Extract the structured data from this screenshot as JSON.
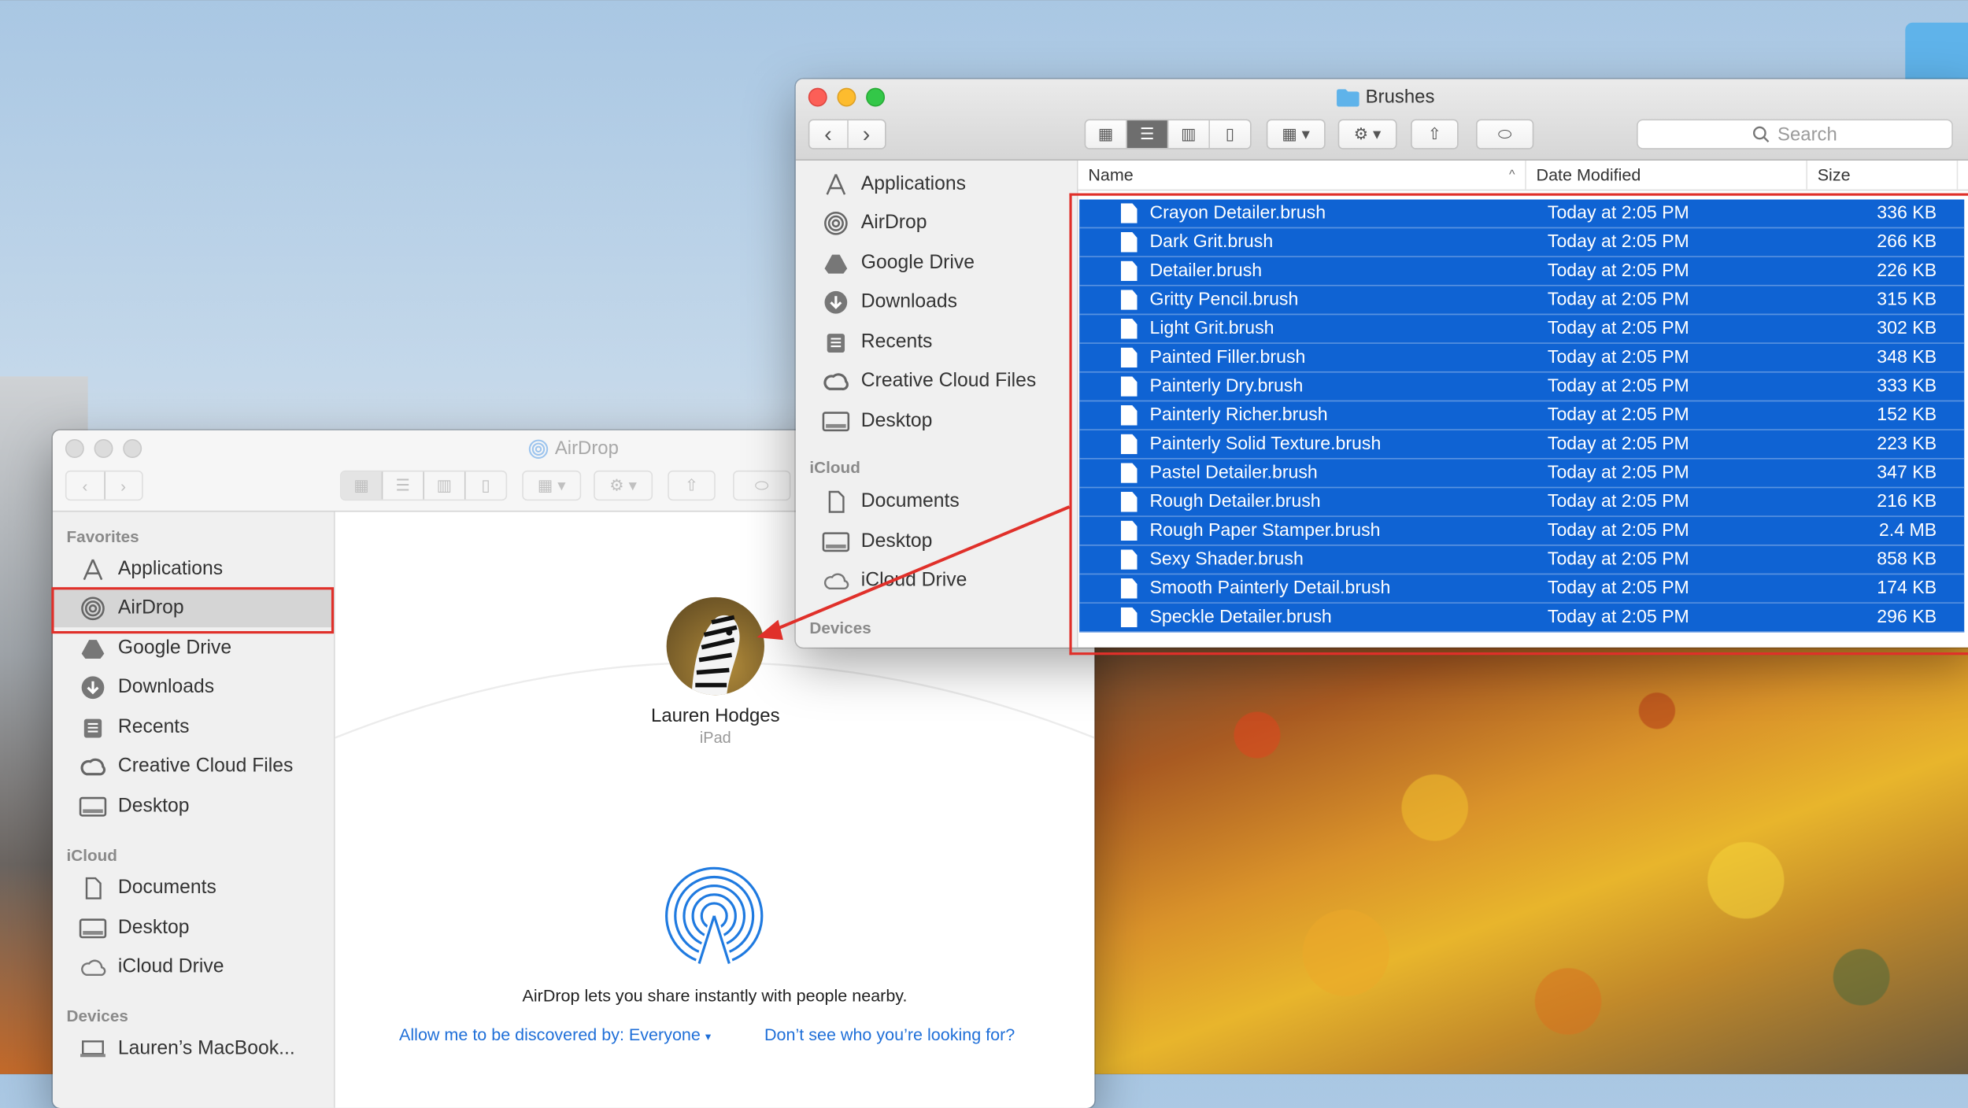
{
  "back_window": {
    "title": "AirDrop",
    "sidebar": {
      "favorites_label": "Favorites",
      "favorites": [
        {
          "label": "Applications",
          "icon": "applications-icon"
        },
        {
          "label": "AirDrop",
          "icon": "airdrop-icon",
          "selected": true
        },
        {
          "label": "Google Drive",
          "icon": "google-drive-icon"
        },
        {
          "label": "Downloads",
          "icon": "downloads-icon"
        },
        {
          "label": "Recents",
          "icon": "recents-icon"
        },
        {
          "label": "Creative Cloud Files",
          "icon": "creative-cloud-icon"
        },
        {
          "label": "Desktop",
          "icon": "desktop-icon"
        }
      ],
      "icloud_label": "iCloud",
      "icloud": [
        {
          "label": "Documents",
          "icon": "documents-icon"
        },
        {
          "label": "Desktop",
          "icon": "desktop-icon"
        },
        {
          "label": "iCloud Drive",
          "icon": "icloud-drive-icon"
        }
      ],
      "devices_label": "Devices",
      "devices": [
        {
          "label": "Lauren’s MacBook...",
          "icon": "laptop-icon"
        }
      ]
    },
    "main": {
      "person_name": "Lauren Hodges",
      "person_device": "iPad",
      "info_text": "AirDrop lets you share instantly with people nearby.",
      "discover_link": "Allow me to be discovered by: Everyone",
      "help_link": "Don’t see who you’re looking for?"
    }
  },
  "front_window": {
    "title": "Brushes",
    "search_placeholder": "Search",
    "sidebar": {
      "items": [
        {
          "label": "Applications",
          "icon": "applications-icon"
        },
        {
          "label": "AirDrop",
          "icon": "airdrop-icon"
        },
        {
          "label": "Google Drive",
          "icon": "google-drive-icon"
        },
        {
          "label": "Downloads",
          "icon": "downloads-icon"
        },
        {
          "label": "Recents",
          "icon": "recents-icon"
        },
        {
          "label": "Creative Cloud Files",
          "icon": "creative-cloud-icon"
        },
        {
          "label": "Desktop",
          "icon": "desktop-icon"
        }
      ],
      "icloud_label": "iCloud",
      "icloud": [
        {
          "label": "Documents",
          "icon": "documents-icon"
        },
        {
          "label": "Desktop",
          "icon": "desktop-icon"
        },
        {
          "label": "iCloud Drive",
          "icon": "icloud-drive-icon"
        }
      ],
      "devices_label": "Devices"
    },
    "columns": {
      "name": "Name",
      "date": "Date Modified",
      "size": "Size"
    },
    "files": [
      {
        "name": "Crayon Detailer.brush",
        "date": "Today at 2:05 PM",
        "size": "336 KB"
      },
      {
        "name": "Dark Grit.brush",
        "date": "Today at 2:05 PM",
        "size": "266 KB"
      },
      {
        "name": "Detailer.brush",
        "date": "Today at 2:05 PM",
        "size": "226 KB"
      },
      {
        "name": "Gritty Pencil.brush",
        "date": "Today at 2:05 PM",
        "size": "315 KB"
      },
      {
        "name": "Light Grit.brush",
        "date": "Today at 2:05 PM",
        "size": "302 KB"
      },
      {
        "name": "Painted Filler.brush",
        "date": "Today at 2:05 PM",
        "size": "348 KB"
      },
      {
        "name": "Painterly Dry.brush",
        "date": "Today at 2:05 PM",
        "size": "333 KB"
      },
      {
        "name": "Painterly Richer.brush",
        "date": "Today at 2:05 PM",
        "size": "152 KB"
      },
      {
        "name": "Painterly Solid Texture.brush",
        "date": "Today at 2:05 PM",
        "size": "223 KB"
      },
      {
        "name": "Pastel Detailer.brush",
        "date": "Today at 2:05 PM",
        "size": "347 KB"
      },
      {
        "name": "Rough Detailer.brush",
        "date": "Today at 2:05 PM",
        "size": "216 KB"
      },
      {
        "name": "Rough Paper Stamper.brush",
        "date": "Today at 2:05 PM",
        "size": "2.4 MB"
      },
      {
        "name": "Sexy Shader.brush",
        "date": "Today at 2:05 PM",
        "size": "858 KB"
      },
      {
        "name": "Smooth Painterly Detail.brush",
        "date": "Today at 2:05 PM",
        "size": "174 KB"
      },
      {
        "name": "Speckle Detailer.brush",
        "date": "Today at 2:05 PM",
        "size": "296 KB"
      }
    ]
  },
  "colors": {
    "selection": "#0f63d3",
    "annotation": "#e0302a",
    "airdrop_blue": "#1f7ae0"
  }
}
